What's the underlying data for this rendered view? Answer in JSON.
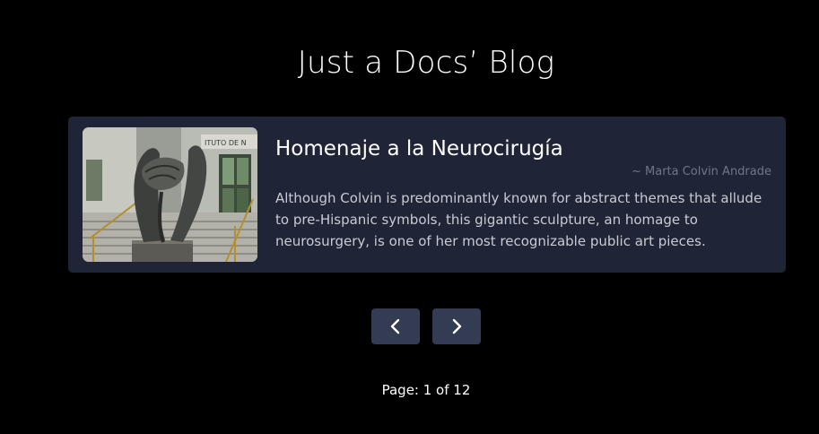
{
  "blog": {
    "title": "Just a Docs’ Blog"
  },
  "post": {
    "title": "Homenaje a la Neurocirugía",
    "author": "~ Marta Colvin Andrade",
    "excerpt": "Although Colvin is predominantly known for abstract themes that allude to pre-Hispanic symbols, this gigantic sculpture, an homage to neurosurgery, is one of her most recognizable public art pieces.",
    "image_sign_text": "ITUTO DE N"
  },
  "pagination": {
    "prev_icon": "chevron-left-icon",
    "next_icon": "chevron-right-icon",
    "status": "Page: 1 of 12"
  },
  "colors": {
    "background": "#000000",
    "card": "#1f2537",
    "button": "#333c52",
    "author_text": "#6f7689",
    "body_text": "#c8cbd3"
  }
}
